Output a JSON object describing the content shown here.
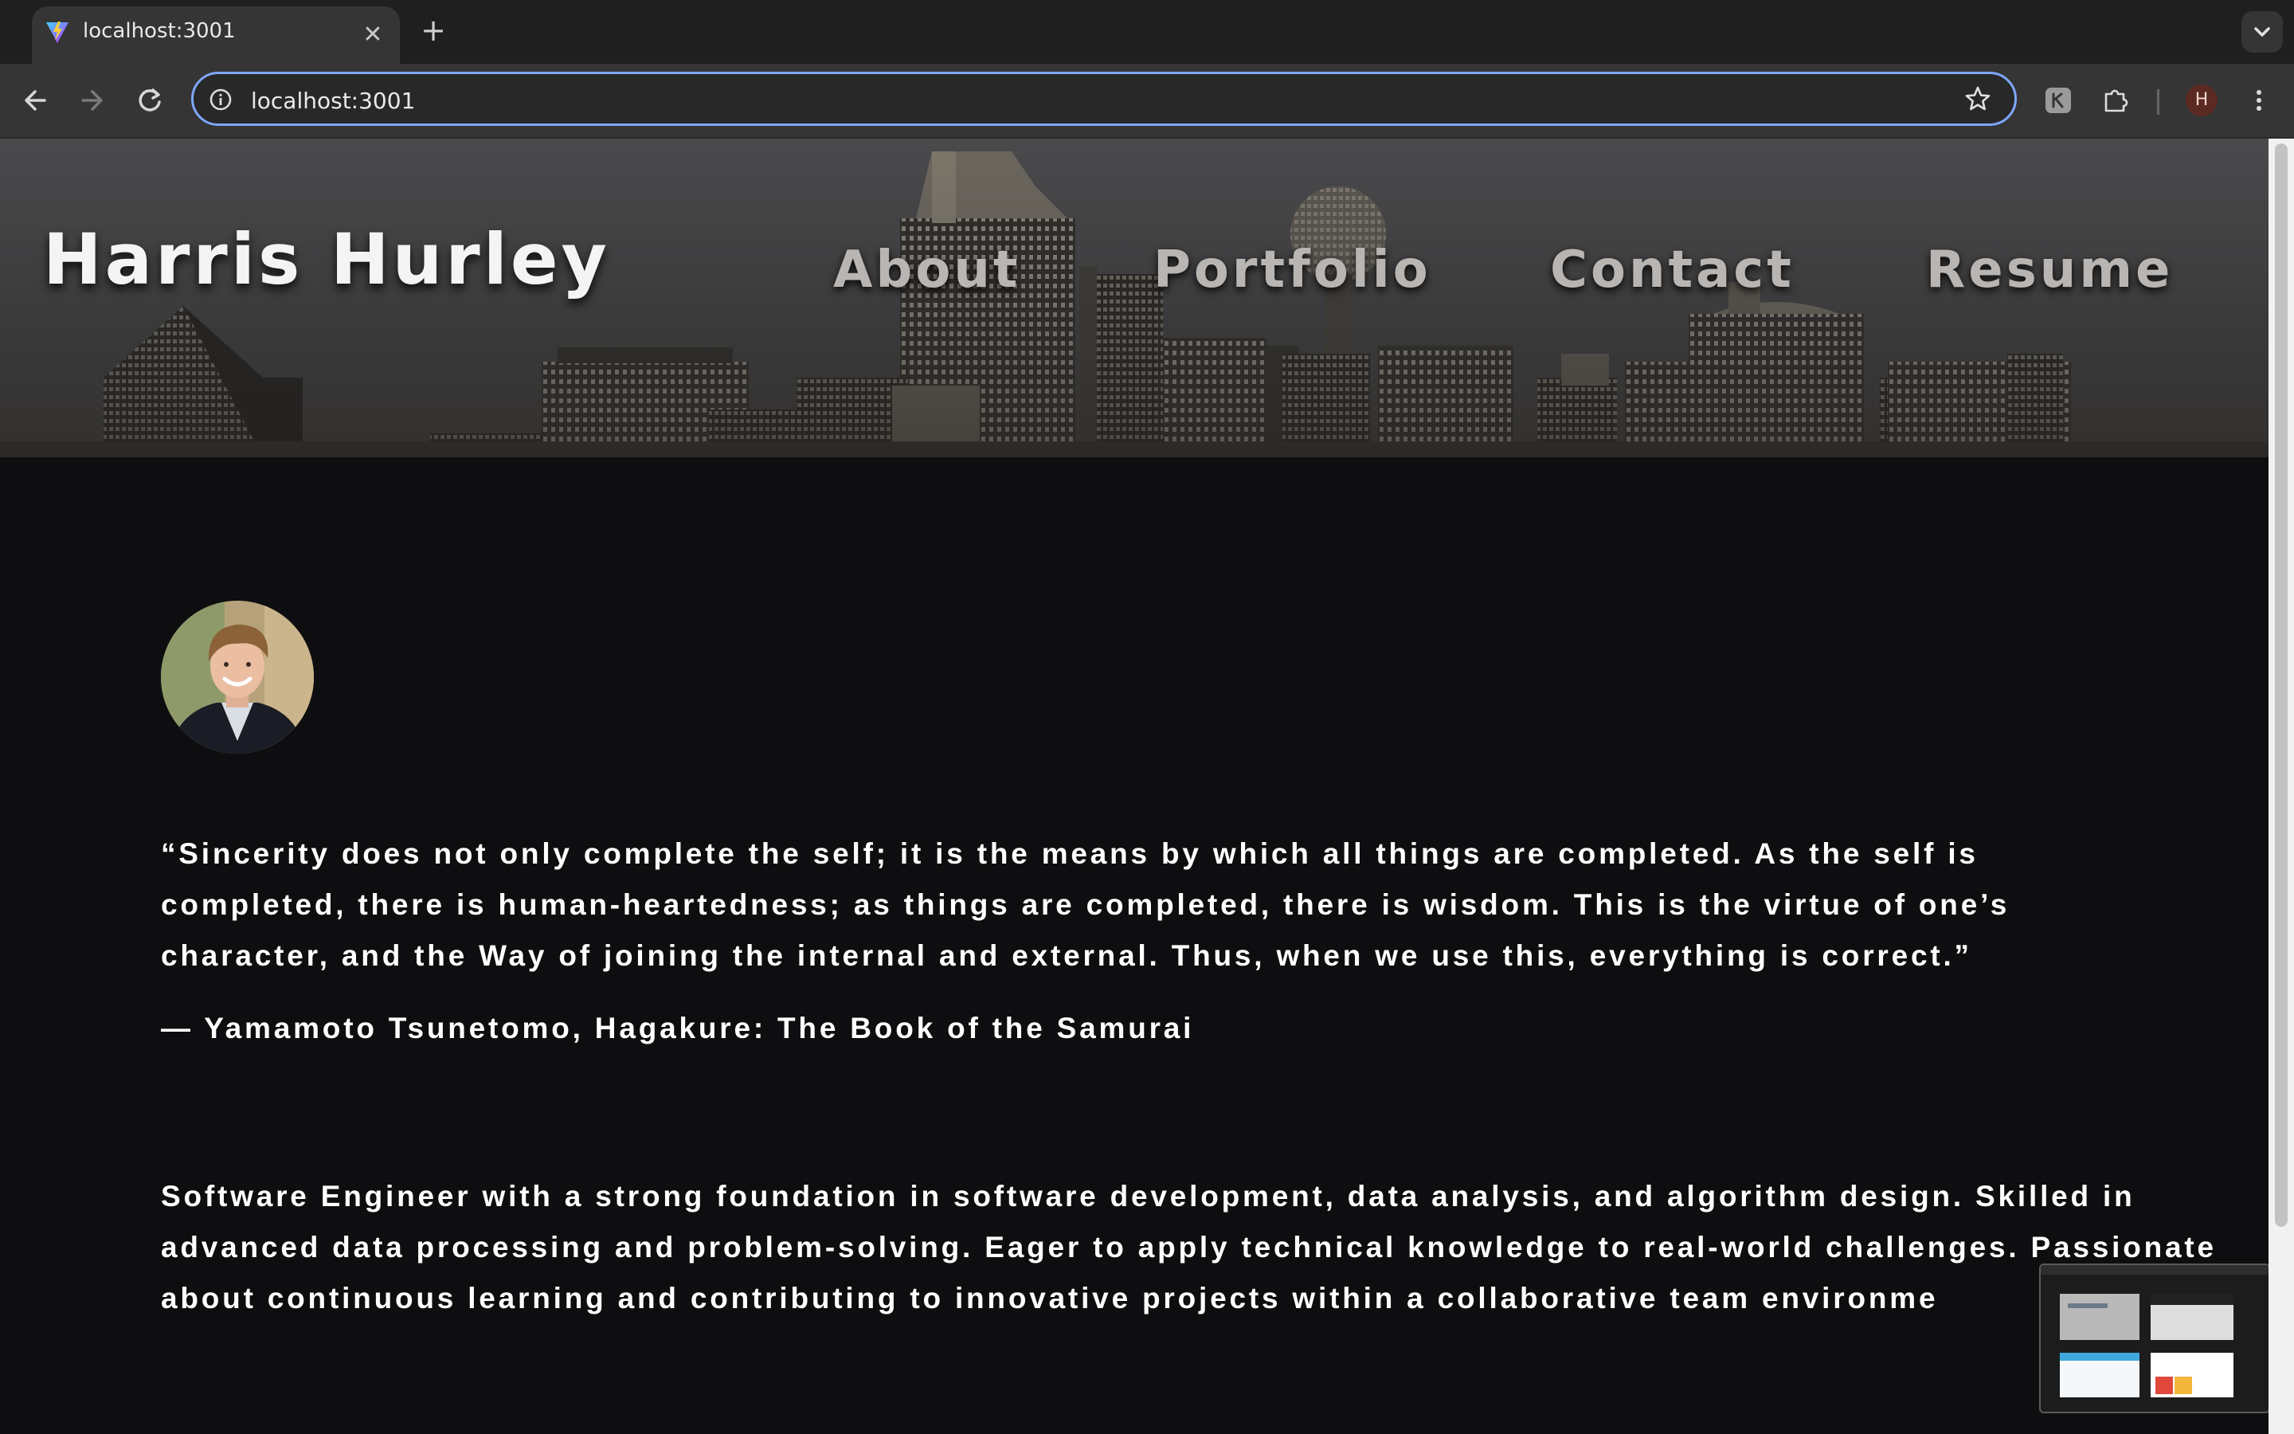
{
  "browser": {
    "tab_title": "localhost:3001",
    "tab_close": "✕",
    "new_tab": "+",
    "url": "localhost:3001",
    "profile_initial": "H"
  },
  "site": {
    "name": "Harris Hurley",
    "nav": [
      "About",
      "Portfolio",
      "Contact",
      "Resume"
    ]
  },
  "content": {
    "quote": "“Sincerity does not only complete the self; it is the means by which all things are completed. As the self is completed, there is human-heartedness; as things are completed, there is wisdom. This is the virtue of one’s character, and the Way of joining the internal and external. Thus, when we use this, everything is correct.”",
    "attribution": "— Yamamoto Tsunetomo, Hagakure: The Book of the Samurai",
    "bio": "Software Engineer with a strong foundation in software development, data analysis, and algorithm design. Skilled in advanced data processing and problem-solving. Eager to apply technical knowledge to real-world challenges. Passionate about continuous learning and contributing to innovative projects within a collaborative team environme"
  },
  "icons": {
    "back": "arrow-left-icon",
    "forward": "arrow-right-icon",
    "reload": "reload-icon",
    "info": "info-icon",
    "bookmark": "star-icon",
    "extension": "puzzle-icon",
    "menu": "kebab-menu-icon"
  },
  "colors": {
    "page_background": "#0e0e10",
    "hero_background": "#3b3b3d",
    "text": "#ffffff",
    "nav_text": "#b8b5b2",
    "omnibox_focus": "#7ea7ff"
  }
}
